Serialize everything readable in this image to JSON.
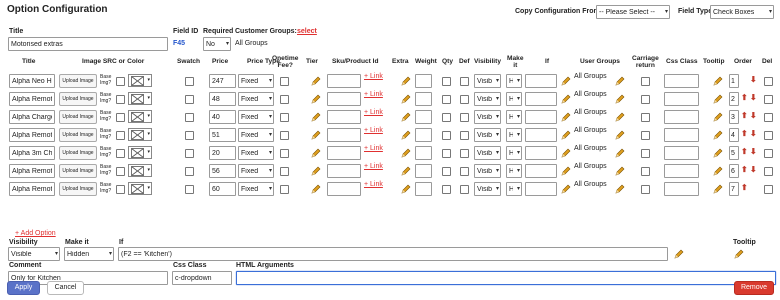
{
  "page": {
    "title": "Option Configuration"
  },
  "copy_config": {
    "label": "Copy Configuration From:",
    "value": "-- Please Select --"
  },
  "field_type": {
    "label": "Field Type:",
    "value": "Check Boxes"
  },
  "option": {
    "title_label": "Title",
    "title_value": "Motorised extras",
    "field_id_label": "Field ID",
    "field_id_value": "F45",
    "required_label": "Required",
    "required_value": "No",
    "customer_groups_label": "Customer Groups:",
    "customer_groups_select": "select",
    "customer_groups_value": "All Groups"
  },
  "table": {
    "headers": {
      "title": "Title",
      "image": "Image SRC or Color",
      "swatch": "Swatch",
      "price": "Price",
      "price_type": "Price Type",
      "onetime": "Onetime\nFee?",
      "tier": "Tier",
      "sku": "Sku/Product Id",
      "extra": "Extra",
      "weight": "Weight",
      "qty": "Qty",
      "def": "Def",
      "visibility": "Visibility",
      "make_it": "Make\nit",
      "if": "If",
      "user_groups": "User Groups",
      "carriage": "Carriage\nreturn",
      "css_class": "Css Class",
      "tooltip": "Tooltip",
      "order": "Order",
      "del": "Del"
    },
    "upload_label": "Upload Image",
    "base_img_label": "Base\nImg?",
    "link_label": "+ Link",
    "rows": [
      {
        "title": "Alpha Neo Hu",
        "price": "247",
        "price_type": "Fixed",
        "visibility": "Visib",
        "make_it": "H",
        "user_groups": "All Groups",
        "order": "1"
      },
      {
        "title": "Alpha Remote",
        "price": "48",
        "price_type": "Fixed",
        "visibility": "Visib",
        "make_it": "H",
        "user_groups": "All Groups",
        "order": "2"
      },
      {
        "title": "Alpha Charge",
        "price": "40",
        "price_type": "Fixed",
        "visibility": "Visib",
        "make_it": "H",
        "user_groups": "All Groups",
        "order": "3"
      },
      {
        "title": "Alpha Remote",
        "price": "51",
        "price_type": "Fixed",
        "visibility": "Visib",
        "make_it": "H",
        "user_groups": "All Groups",
        "order": "4"
      },
      {
        "title": "Alpha 3m Cha",
        "price": "20",
        "price_type": "Fixed",
        "visibility": "Visib",
        "make_it": "H",
        "user_groups": "All Groups",
        "order": "5"
      },
      {
        "title": "Alpha Remote",
        "price": "56",
        "price_type": "Fixed",
        "visibility": "Visib",
        "make_it": "H",
        "user_groups": "All Groups",
        "order": "6"
      },
      {
        "title": "Alpha Remote",
        "price": "60",
        "price_type": "Fixed",
        "visibility": "Visib",
        "make_it": "H",
        "user_groups": "All Groups",
        "order": "7"
      }
    ],
    "add_option": "+ Add Option"
  },
  "lower": {
    "visibility_label": "Visibility",
    "visibility_value": "Visible",
    "make_it_label": "Make it",
    "make_it_value": "Hidden",
    "if_label": "If",
    "if_value": "(F2 == 'Kitchen')",
    "tooltip_label": "Tooltip",
    "comment_label": "Comment",
    "comment_value": "Only for Kitchen",
    "css_label": "Css Class",
    "css_value": "c-dropdown",
    "html_label": "HTML Arguments",
    "html_value": ""
  },
  "buttons": {
    "apply": "Apply",
    "cancel": "Cancel",
    "remove": "Remove"
  },
  "colors": {
    "link": "#e03030",
    "apply_bg": "#5a72c8",
    "remove_bg": "#d93a2e",
    "pencil": "#e0a020",
    "arrow": "#c0392b",
    "field_id": "#2255cc"
  }
}
